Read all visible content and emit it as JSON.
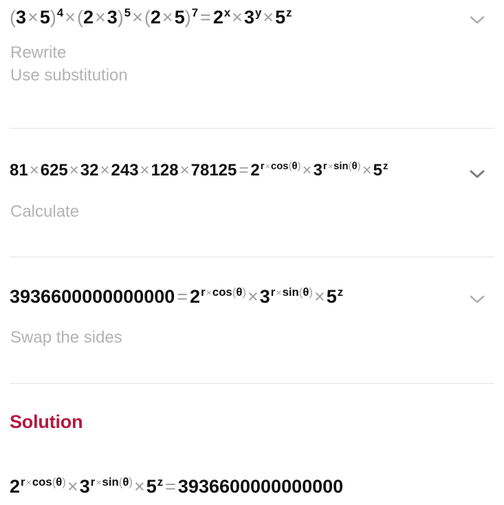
{
  "app": {
    "background": "#ffffff",
    "text_color": "#101010",
    "muted_color": "#b3b3b3",
    "operator_color": "#9e9e9e",
    "divider_color": "#e2e2e2",
    "accent_color": "#b5183f"
  },
  "steps": [
    {
      "id": "step-1",
      "equation_text": "(3 × 5)^4 × (2 × 3)^5 × (2 × 5)^7 = 2^x × 3^y × 5^z",
      "left": {
        "factors": [
          {
            "base": "(3 × 5)",
            "exponent": "4"
          },
          {
            "base": "(2 × 3)",
            "exponent": "5"
          },
          {
            "base": "(2 × 5)",
            "exponent": "7"
          }
        ]
      },
      "right": {
        "factors": [
          {
            "base": "2",
            "exponent": "x"
          },
          {
            "base": "3",
            "exponent": "y"
          },
          {
            "base": "5",
            "exponent": "z"
          }
        ]
      },
      "hints": [
        "Rewrite",
        "Use substitution"
      ],
      "expand_icon": "chevron-down-icon"
    },
    {
      "id": "step-2",
      "equation_text": "81 × 625 × 32 × 243 × 128 × 78125 = 2^(r × cos(θ)) × 3^(r × sin(θ)) × 5^z",
      "left": {
        "terms": [
          "81",
          "625",
          "32",
          "243",
          "128",
          "78125"
        ]
      },
      "right": {
        "factors": [
          {
            "base": "2",
            "exponent": "r × cos(θ)"
          },
          {
            "base": "3",
            "exponent": "r × sin(θ)"
          },
          {
            "base": "5",
            "exponent": "z"
          }
        ]
      },
      "hints": [
        "Calculate"
      ],
      "expand_icon": "chevron-down-icon"
    },
    {
      "id": "step-3",
      "equation_text": "3936600000000000 = 2^(r × cos(θ)) × 3^(r × sin(θ)) × 5^z",
      "left": {
        "value": "3936600000000000"
      },
      "right": {
        "factors": [
          {
            "base": "2",
            "exponent": "r × cos(θ)"
          },
          {
            "base": "3",
            "exponent": "r × sin(θ)"
          },
          {
            "base": "5",
            "exponent": "z"
          }
        ]
      },
      "hints": [
        "Swap the sides"
      ],
      "expand_icon": "chevron-down-icon"
    }
  ],
  "solution": {
    "label": "Solution",
    "equation_text": "2^(r × cos(θ)) × 3^(r × sin(θ)) × 5^z = 3936600000000000",
    "left": {
      "factors": [
        {
          "base": "2",
          "exponent": "r × cos(θ)"
        },
        {
          "base": "3",
          "exponent": "r × sin(θ)"
        },
        {
          "base": "5",
          "exponent": "z"
        }
      ]
    },
    "right": {
      "value": "3936600000000000"
    }
  },
  "symbols": {
    "multiply": "×",
    "equals": "=",
    "theta": "θ",
    "paren_open": "(",
    "paren_close": ")",
    "cos": "cos",
    "sin": "sin",
    "r": "r"
  }
}
